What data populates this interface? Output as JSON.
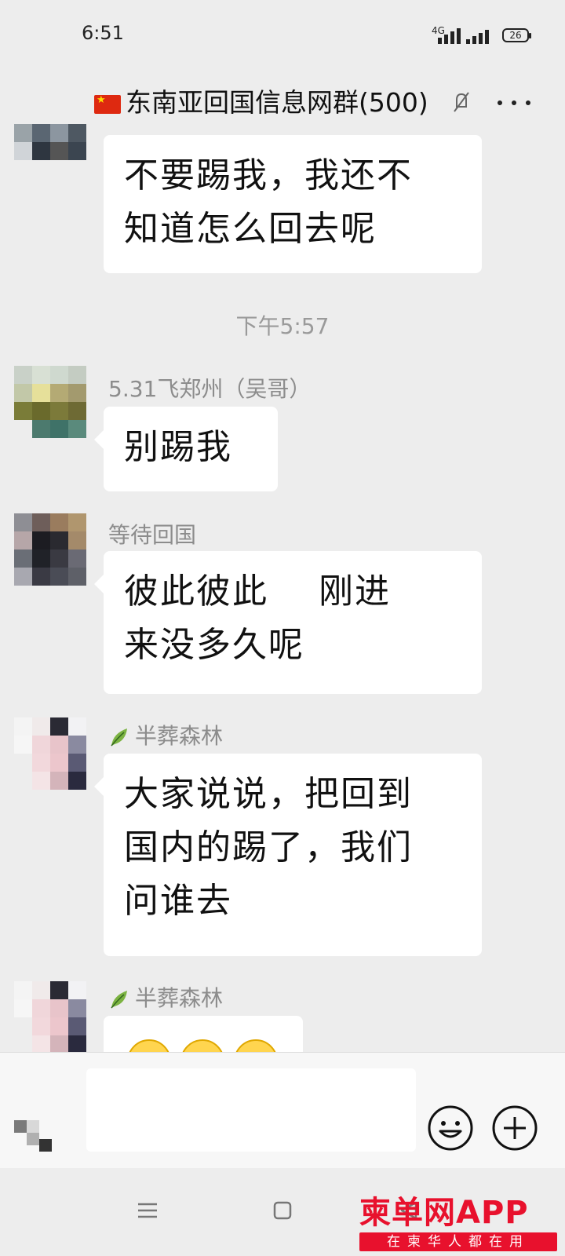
{
  "status_bar": {
    "time": "6:51",
    "network": "4G",
    "battery": "26"
  },
  "nav": {
    "title": "东南亚回国信息网群(500)"
  },
  "time_divider": "下午5:57",
  "messages": [
    {
      "sender": "",
      "text_lines": [
        "不要踢我，我还不",
        "知道怎么回去呢"
      ]
    },
    {
      "sender": "5.31飞郑州（吴哥）",
      "text_lines": [
        "别踢我"
      ]
    },
    {
      "sender": "等待回国",
      "text_lines": [
        "彼此彼此    刚进",
        "来没多久呢"
      ]
    },
    {
      "sender": "半葬森林",
      "text_lines": [
        "大家说说，把回到",
        "国内的踢了，我们",
        "问谁去"
      ]
    },
    {
      "sender": "半葬森林",
      "text_lines": [
        ""
      ]
    }
  ],
  "input_bar": {
    "placeholder": ""
  },
  "watermark": {
    "brand": "柬单网APP",
    "slogan": "在柬华人都在用"
  },
  "colors": {
    "background": "#ededed",
    "bubble": "#ffffff",
    "watermark_red": "#e8112d"
  }
}
